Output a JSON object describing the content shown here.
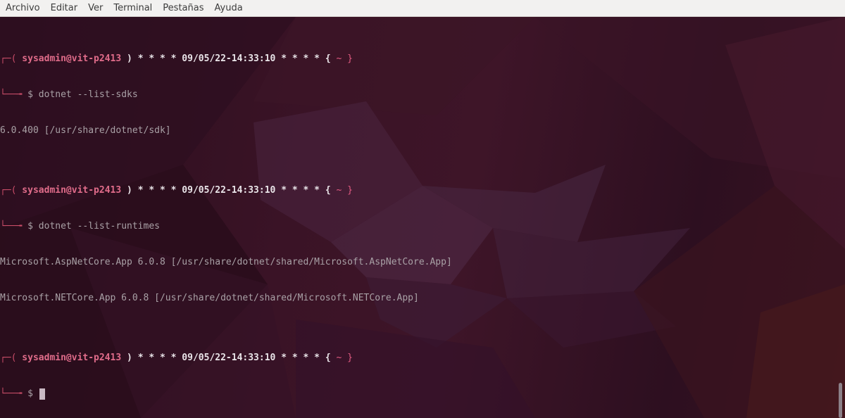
{
  "menubar": {
    "items": [
      "Archivo",
      "Editar",
      "Ver",
      "Terminal",
      "Pestañas",
      "Ayuda"
    ]
  },
  "terminal": {
    "prompt_head": {
      "box_open": "┌─(",
      "user_host": " sysadmin@vit-p2413",
      "close_paren": " ) ",
      "stars_left": "* * * *",
      "datetime": " 09/05/22-14:33:10 ",
      "stars_right": "* * * *",
      "brace_open": " { ",
      "cwd": "~",
      "brace_close": " }"
    },
    "prompt_tail": "└──╼ ",
    "prompt_symbol": "$",
    "commands": [
      {
        "command": "dotnet --list-sdks",
        "output": [
          "6.0.400 [/usr/share/dotnet/sdk]"
        ]
      },
      {
        "command": "dotnet --list-runtimes",
        "output": [
          "Microsoft.AspNetCore.App 6.0.8 [/usr/share/dotnet/shared/Microsoft.AspNetCore.App]",
          "Microsoft.NETCore.App 6.0.8 [/usr/share/dotnet/shared/Microsoft.NETCore.App]"
        ]
      }
    ],
    "current_input": ""
  },
  "colors": {
    "background": "#2b0f1f",
    "prompt_user": "#e06c8a",
    "prompt_box": "#c94d68",
    "text": "#b3a3ad",
    "menubar": "#f2f1f0"
  }
}
